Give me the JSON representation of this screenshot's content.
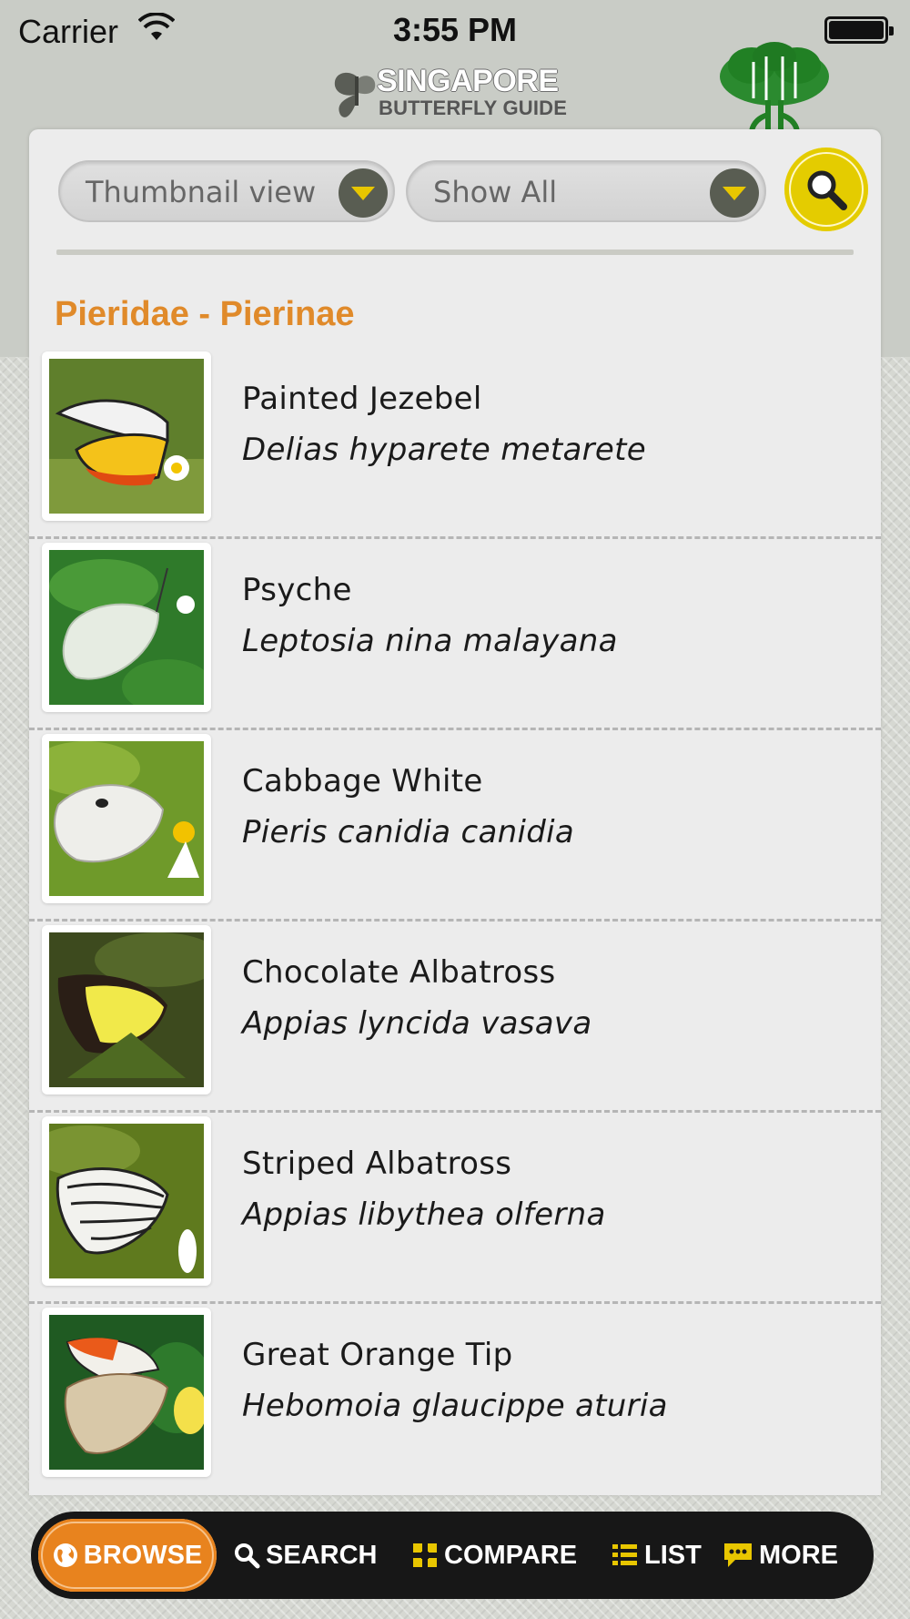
{
  "status_bar": {
    "carrier": "Carrier",
    "time": "3:55 PM",
    "wifi_icon": "wifi-icon",
    "battery_icon": "battery-icon"
  },
  "header": {
    "logo_line1": "SINGAPORE",
    "logo_line2": "BUTTERFLY GUIDE",
    "logo_icon": "butterfly-icon",
    "tree_icon": "tree-icon"
  },
  "filters": {
    "view_selected": "Thumbnail view",
    "category_selected": "Show All",
    "search_icon": "magnifier-icon"
  },
  "section": {
    "title": "Pieridae - Pierinae"
  },
  "species": [
    {
      "common": "Painted Jezebel",
      "scientific": "Delias hyparete metarete"
    },
    {
      "common": "Psyche",
      "scientific": "Leptosia nina malayana"
    },
    {
      "common": "Cabbage White",
      "scientific": "Pieris canidia canidia"
    },
    {
      "common": "Chocolate Albatross",
      "scientific": "Appias lyncida vasava"
    },
    {
      "common": "Striped Albatross",
      "scientific": "Appias libythea olferna"
    },
    {
      "common": "Great Orange Tip",
      "scientific": "Hebomoia glaucippe aturia"
    }
  ],
  "tabbar": {
    "browse": "BROWSE",
    "search": "SEARCH",
    "compare": "COMPARE",
    "list": "LIST",
    "more": "MORE"
  },
  "colors": {
    "accent_orange": "#e8831e",
    "section_title": "#e08a2a",
    "search_yellow": "#e4cc00",
    "tabbar_bg": "#171717"
  }
}
